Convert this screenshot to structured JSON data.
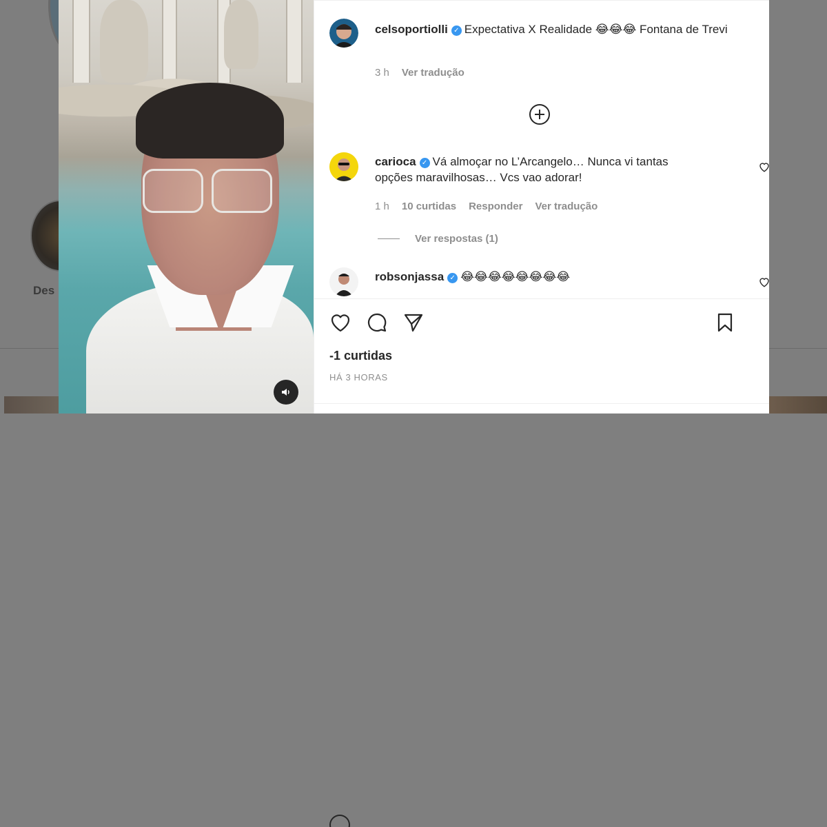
{
  "background": {
    "story_label": "Des"
  },
  "post": {
    "caption": {
      "username": "celsoportiolli",
      "text": "Expectativa X Realidade 😂😂😂 Fontana de Trevi",
      "time": "3 h",
      "translate": "Ver tradução"
    },
    "comments": [
      {
        "username": "carioca",
        "text": "Vá almoçar no L’Arcangelo… Nunca vi tantas opções maravilhosas… Vcs vao adorar!",
        "time": "1 h",
        "likes": "10 curtidas",
        "reply": "Responder",
        "translate": "Ver tradução",
        "view_replies": "Ver respostas (1)"
      },
      {
        "username": "robsonjassa",
        "text": "😂😂😂😂😂😂😂😂"
      }
    ],
    "likes_count": "-1 curtidas",
    "posted_ago": "HÁ 3 HORAS"
  },
  "icons": {
    "verified": "verified-badge-icon",
    "like": "heart-icon",
    "comment": "comment-bubble-icon",
    "share": "paper-plane-icon",
    "save": "bookmark-icon",
    "load_more": "plus-circle-icon",
    "mute": "speaker-icon"
  },
  "colors": {
    "verified": "#3897f0",
    "text_primary": "#262626",
    "text_secondary": "#8e8e8e",
    "overlay": "#7f7f7f"
  }
}
